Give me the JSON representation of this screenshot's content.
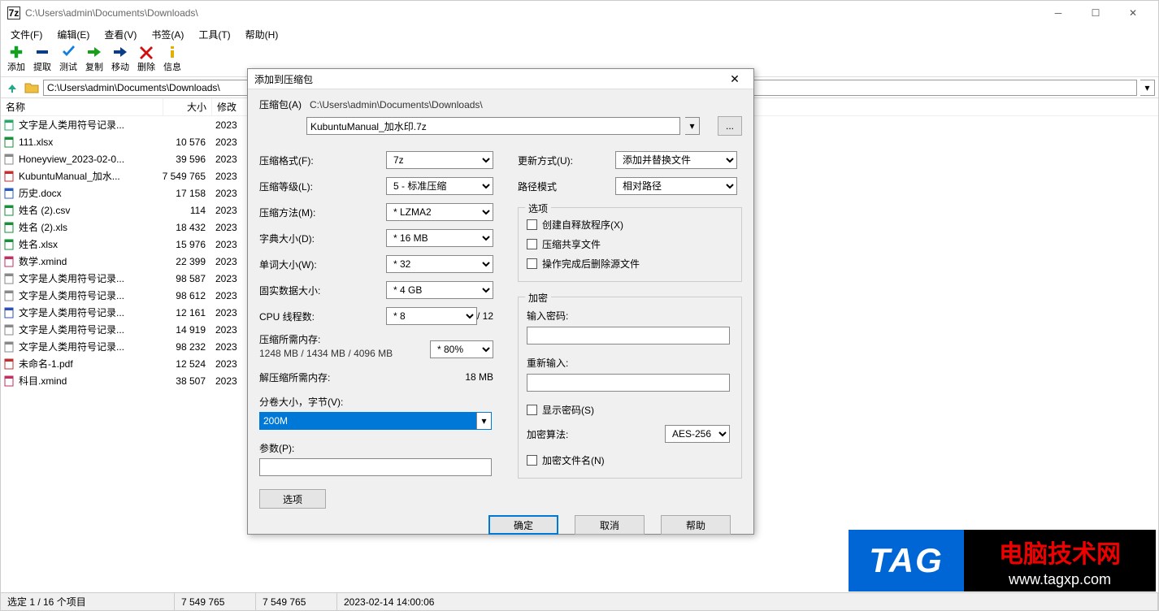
{
  "window": {
    "title": "C:\\Users\\admin\\Documents\\Downloads\\",
    "app_icon_text": "7z"
  },
  "menu": {
    "file": "文件(F)",
    "edit": "编辑(E)",
    "view": "查看(V)",
    "bookmark": "书签(A)",
    "tool": "工具(T)",
    "help": "帮助(H)"
  },
  "toolbar": {
    "add": "添加",
    "extract": "提取",
    "test": "测试",
    "copy": "复制",
    "move": "移动",
    "delete": "删除",
    "info": "信息"
  },
  "address": {
    "path": "C:\\Users\\admin\\Documents\\Downloads\\"
  },
  "columns": {
    "name": "名称",
    "size": "大小",
    "modified": "修改"
  },
  "files": [
    {
      "icon": "doc",
      "name": "文字是人类用符号记录...",
      "size": "",
      "date": "2023"
    },
    {
      "icon": "xlsx",
      "name": "111.xlsx",
      "size": "10 576",
      "date": "2023"
    },
    {
      "icon": "img",
      "name": "Honeyview_2023-02-0...",
      "size": "39 596",
      "date": "2023"
    },
    {
      "icon": "pdf",
      "name": "KubuntuManual_加水...",
      "size": "7 549 765",
      "date": "2023"
    },
    {
      "icon": "docx",
      "name": "历史.docx",
      "size": "17 158",
      "date": "2023"
    },
    {
      "icon": "csv",
      "name": "姓名 (2).csv",
      "size": "114",
      "date": "2023"
    },
    {
      "icon": "xls",
      "name": "姓名 (2).xls",
      "size": "18 432",
      "date": "2023"
    },
    {
      "icon": "xlsx",
      "name": "姓名.xlsx",
      "size": "15 976",
      "date": "2023"
    },
    {
      "icon": "xmind",
      "name": "数学.xmind",
      "size": "22 399",
      "date": "2023"
    },
    {
      "icon": "txt",
      "name": "文字是人类用符号记录...",
      "size": "98 587",
      "date": "2023"
    },
    {
      "icon": "txt",
      "name": "文字是人类用符号记录...",
      "size": "98 612",
      "date": "2023"
    },
    {
      "icon": "rar",
      "name": "文字是人类用符号记录...",
      "size": "12 161",
      "date": "2023"
    },
    {
      "icon": "txt",
      "name": "文字是人类用符号记录...",
      "size": "14 919",
      "date": "2023"
    },
    {
      "icon": "txt",
      "name": "文字是人类用符号记录...",
      "size": "98 232",
      "date": "2023"
    },
    {
      "icon": "pdf",
      "name": "未命名-1.pdf",
      "size": "12 524",
      "date": "2023"
    },
    {
      "icon": "xmind",
      "name": "科目.xmind",
      "size": "38 507",
      "date": "2023"
    }
  ],
  "status": {
    "selection": "选定 1 / 16 个项目",
    "size1": "7 549 765",
    "size2": "7 549 765",
    "datetime": "2023-02-14 14:00:06"
  },
  "dialog": {
    "title": "添加到压缩包",
    "archive_label": "压缩包(A)",
    "archive_path": "C:\\Users\\admin\\Documents\\Downloads\\",
    "archive_name": "KubuntuManual_加水印.7z",
    "format_label": "压缩格式(F):",
    "format_value": "7z",
    "level_label": "压缩等级(L):",
    "level_value": "5 - 标准压缩",
    "method_label": "压缩方法(M):",
    "method_value": "* LZMA2",
    "dict_label": "字典大小(D):",
    "dict_value": "* 16 MB",
    "word_label": "单词大小(W):",
    "word_value": "* 32",
    "solid_label": "固实数据大小:",
    "solid_value": "* 4 GB",
    "cpu_label": "CPU 线程数:",
    "cpu_value": "* 8",
    "cpu_total": "/ 12",
    "memc_label": "压缩所需内存:",
    "memc_value": "1248 MB / 1434 MB / 4096 MB",
    "memc_pct": "* 80%",
    "memd_label": "解压缩所需内存:",
    "memd_value": "18 MB",
    "volume_label": "分卷大小，字节(V):",
    "volume_value": "200M",
    "param_label": "参数(P):",
    "param_value": "",
    "options_btn": "选项",
    "update_label": "更新方式(U):",
    "update_value": "添加并替换文件",
    "pathmode_label": "路径模式",
    "pathmode_value": "相对路径",
    "opt_group": "选项",
    "opt_sfx": "创建自释放程序(X)",
    "opt_share": "压缩共享文件",
    "opt_delete": "操作完成后删除源文件",
    "enc_group": "加密",
    "enc_pass_label": "输入密码:",
    "enc_pass2_label": "重新输入:",
    "enc_show": "显示密码(S)",
    "enc_algo_label": "加密算法:",
    "enc_algo_value": "AES-256",
    "enc_names": "加密文件名(N)",
    "ok": "确定",
    "cancel": "取消",
    "help": "帮助"
  },
  "watermark": {
    "tag": "TAG",
    "line1": "电脑技术网",
    "line2": "www.tagxp.com"
  }
}
